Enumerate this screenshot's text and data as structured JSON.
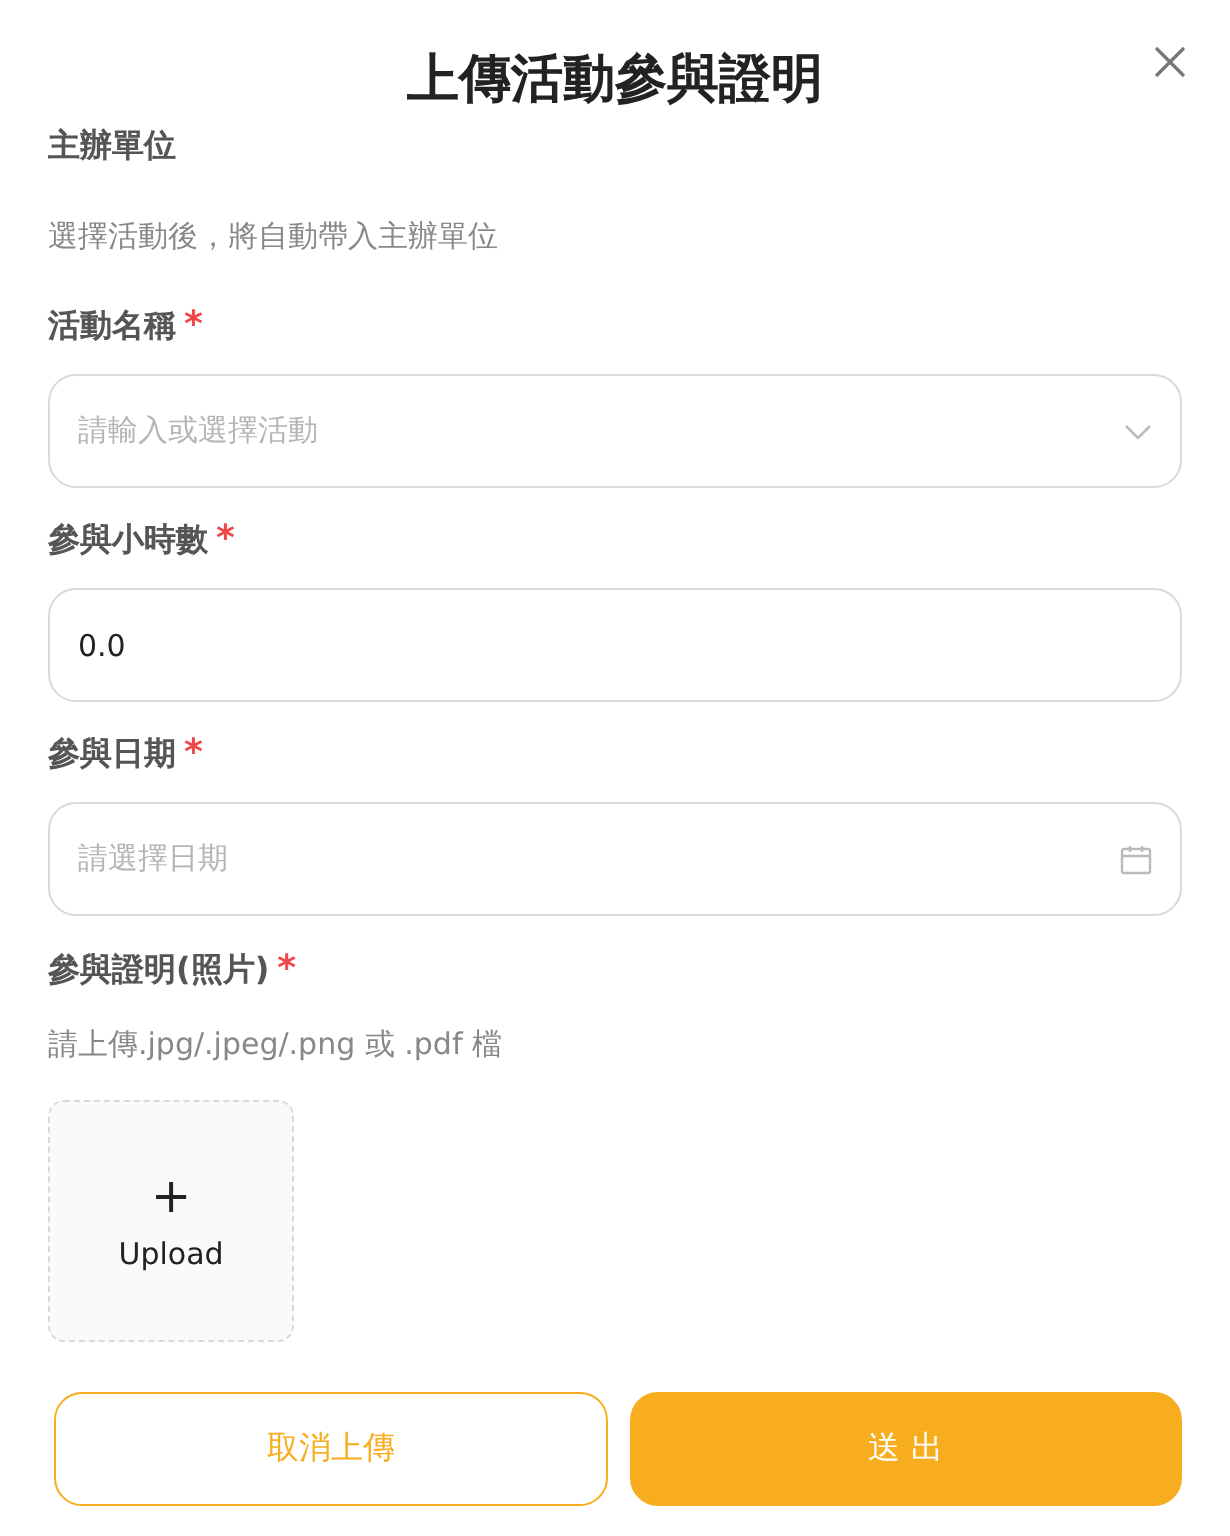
{
  "dialog": {
    "title": "上傳活動參與證明"
  },
  "fields": [
    {
      "kind": "info",
      "label": "主辦單位",
      "required": false,
      "hint": "選擇活動後，將自動帶入主辦單位"
    },
    {
      "kind": "select",
      "label": "活動名稱",
      "required": true,
      "placeholder": "請輸入或選擇活動"
    },
    {
      "kind": "input",
      "label": "參與小時數",
      "required": true,
      "value": "0.0"
    },
    {
      "kind": "date",
      "label": "參與日期",
      "required": true,
      "placeholder": "請選擇日期"
    },
    {
      "kind": "upload",
      "label": "參與證明(照片)",
      "required": true,
      "hint": "請上傳.jpg/.jpeg/.png 或 .pdf 檔",
      "button": "Upload",
      "icon": "+"
    }
  ],
  "required_mark": "*",
  "buttons": [
    {
      "kind": "secondary",
      "label": "取消上傳"
    },
    {
      "kind": "primary",
      "label": "送 出"
    }
  ]
}
